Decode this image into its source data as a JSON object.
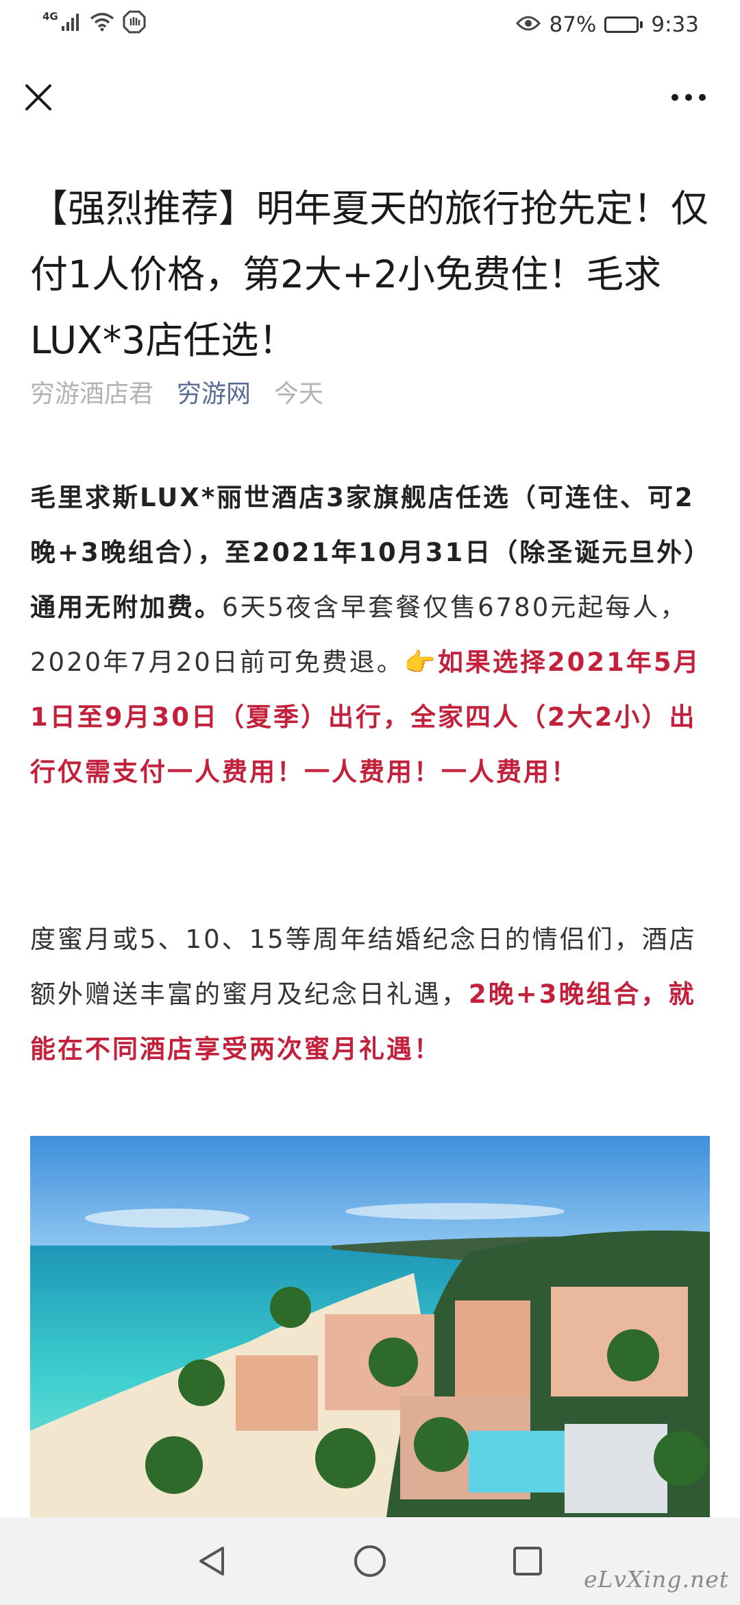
{
  "status_bar": {
    "network": "4G",
    "battery_percent": "87%",
    "battery_level": 0.87,
    "time": "9:33",
    "icons": [
      "signal-icon",
      "wifi-icon",
      "hand-icon",
      "eye-icon",
      "battery-icon"
    ]
  },
  "article": {
    "title": "【强烈推荐】明年夏天的旅行抢先定！仅付1人价格，第2大+2小免费住！毛求LUX*3店任选！",
    "author": "穷游酒店君",
    "source": "穷游网",
    "date": "今天",
    "p1": {
      "bold": "毛里求斯LUX*丽世酒店3家旗舰店任选（可连住、可2晚+3晚组合），至2021年10月31日（除圣诞元旦外）通用无附加费。",
      "normal": "6天5夜含早套餐仅售6780元起每人，2020年7月20日前可免费退。👉",
      "red": "如果选择2021年5月1日至9月30日（夏季）出行，全家四人（2大2小）出行仅需支付一人费用！一人费用！一人费用！"
    },
    "p2": {
      "normal": "度蜜月或5、10、15等周年结婚纪念日的情侣们，酒店额外赠送丰富的蜜月及纪念日礼遇，",
      "red": "2晚+3晚组合，就能在不同酒店享受两次蜜月礼遇！"
    }
  },
  "navigation": {
    "icons": [
      "back-triangle-icon",
      "home-circle-icon",
      "recents-square-icon"
    ]
  },
  "watermark": "eLvXing.net",
  "colors": {
    "link": "#576b95",
    "accent_red": "#c3213b",
    "meta_gray": "#b2b2b2"
  }
}
